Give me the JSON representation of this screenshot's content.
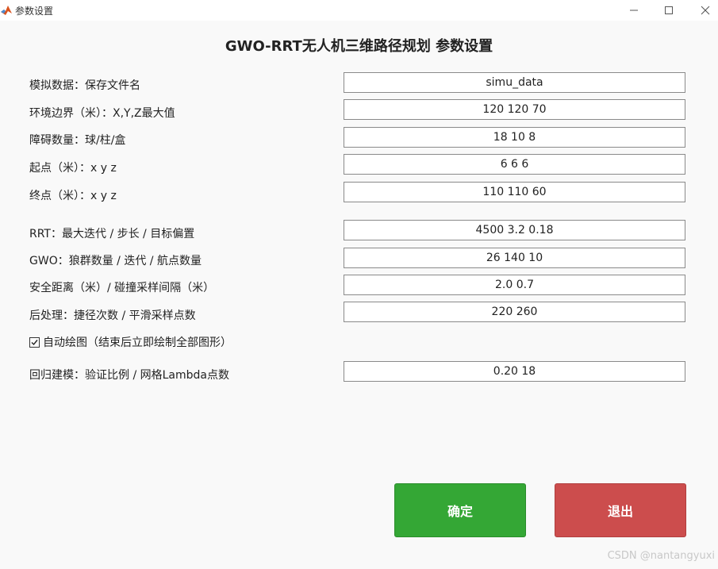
{
  "window": {
    "title": "参数设置",
    "minimize_glyph": "—",
    "maximize_glyph": "☐",
    "close_glyph": "✕"
  },
  "header": {
    "title": "GWO-RRT无人机三维路径规划 参数设置"
  },
  "form": {
    "rows": [
      {
        "label": "模拟数据：保存文件名",
        "value": "simu_data"
      },
      {
        "label": "环境边界（米）：X,Y,Z最大值",
        "value": "120 120 70"
      },
      {
        "label": "障碍数量：球/柱/盒",
        "value": "18 10 8"
      },
      {
        "label": "起点（米）：x y z",
        "value": "6 6 6"
      },
      {
        "label": "终点（米）：x y z",
        "value": "110 110 60"
      },
      {
        "label": "RRT：最大迭代 / 步长 / 目标偏置",
        "value": "4500 3.2 0.18"
      },
      {
        "label": "GWO：狼群数量 / 迭代 / 航点数量",
        "value": "26 140 10"
      },
      {
        "label": "安全距离（米）/ 碰撞采样间隔（米）",
        "value": "2.0 0.7"
      },
      {
        "label": "后处理：捷径次数 / 平滑采样点数",
        "value": "220 260"
      }
    ],
    "autoplot": {
      "label": "自动绘图（结束后立即绘制全部图形）",
      "checked": true
    },
    "regression": {
      "label": "回归建模：验证比例 / 网格Lambda点数",
      "value": "0.20 18"
    }
  },
  "buttons": {
    "ok_label": "确定",
    "exit_label": "退出"
  },
  "watermark": "CSDN @nantangyuxi",
  "colors": {
    "ok_button": "#34a735",
    "exit_button": "#cc4d4d"
  }
}
